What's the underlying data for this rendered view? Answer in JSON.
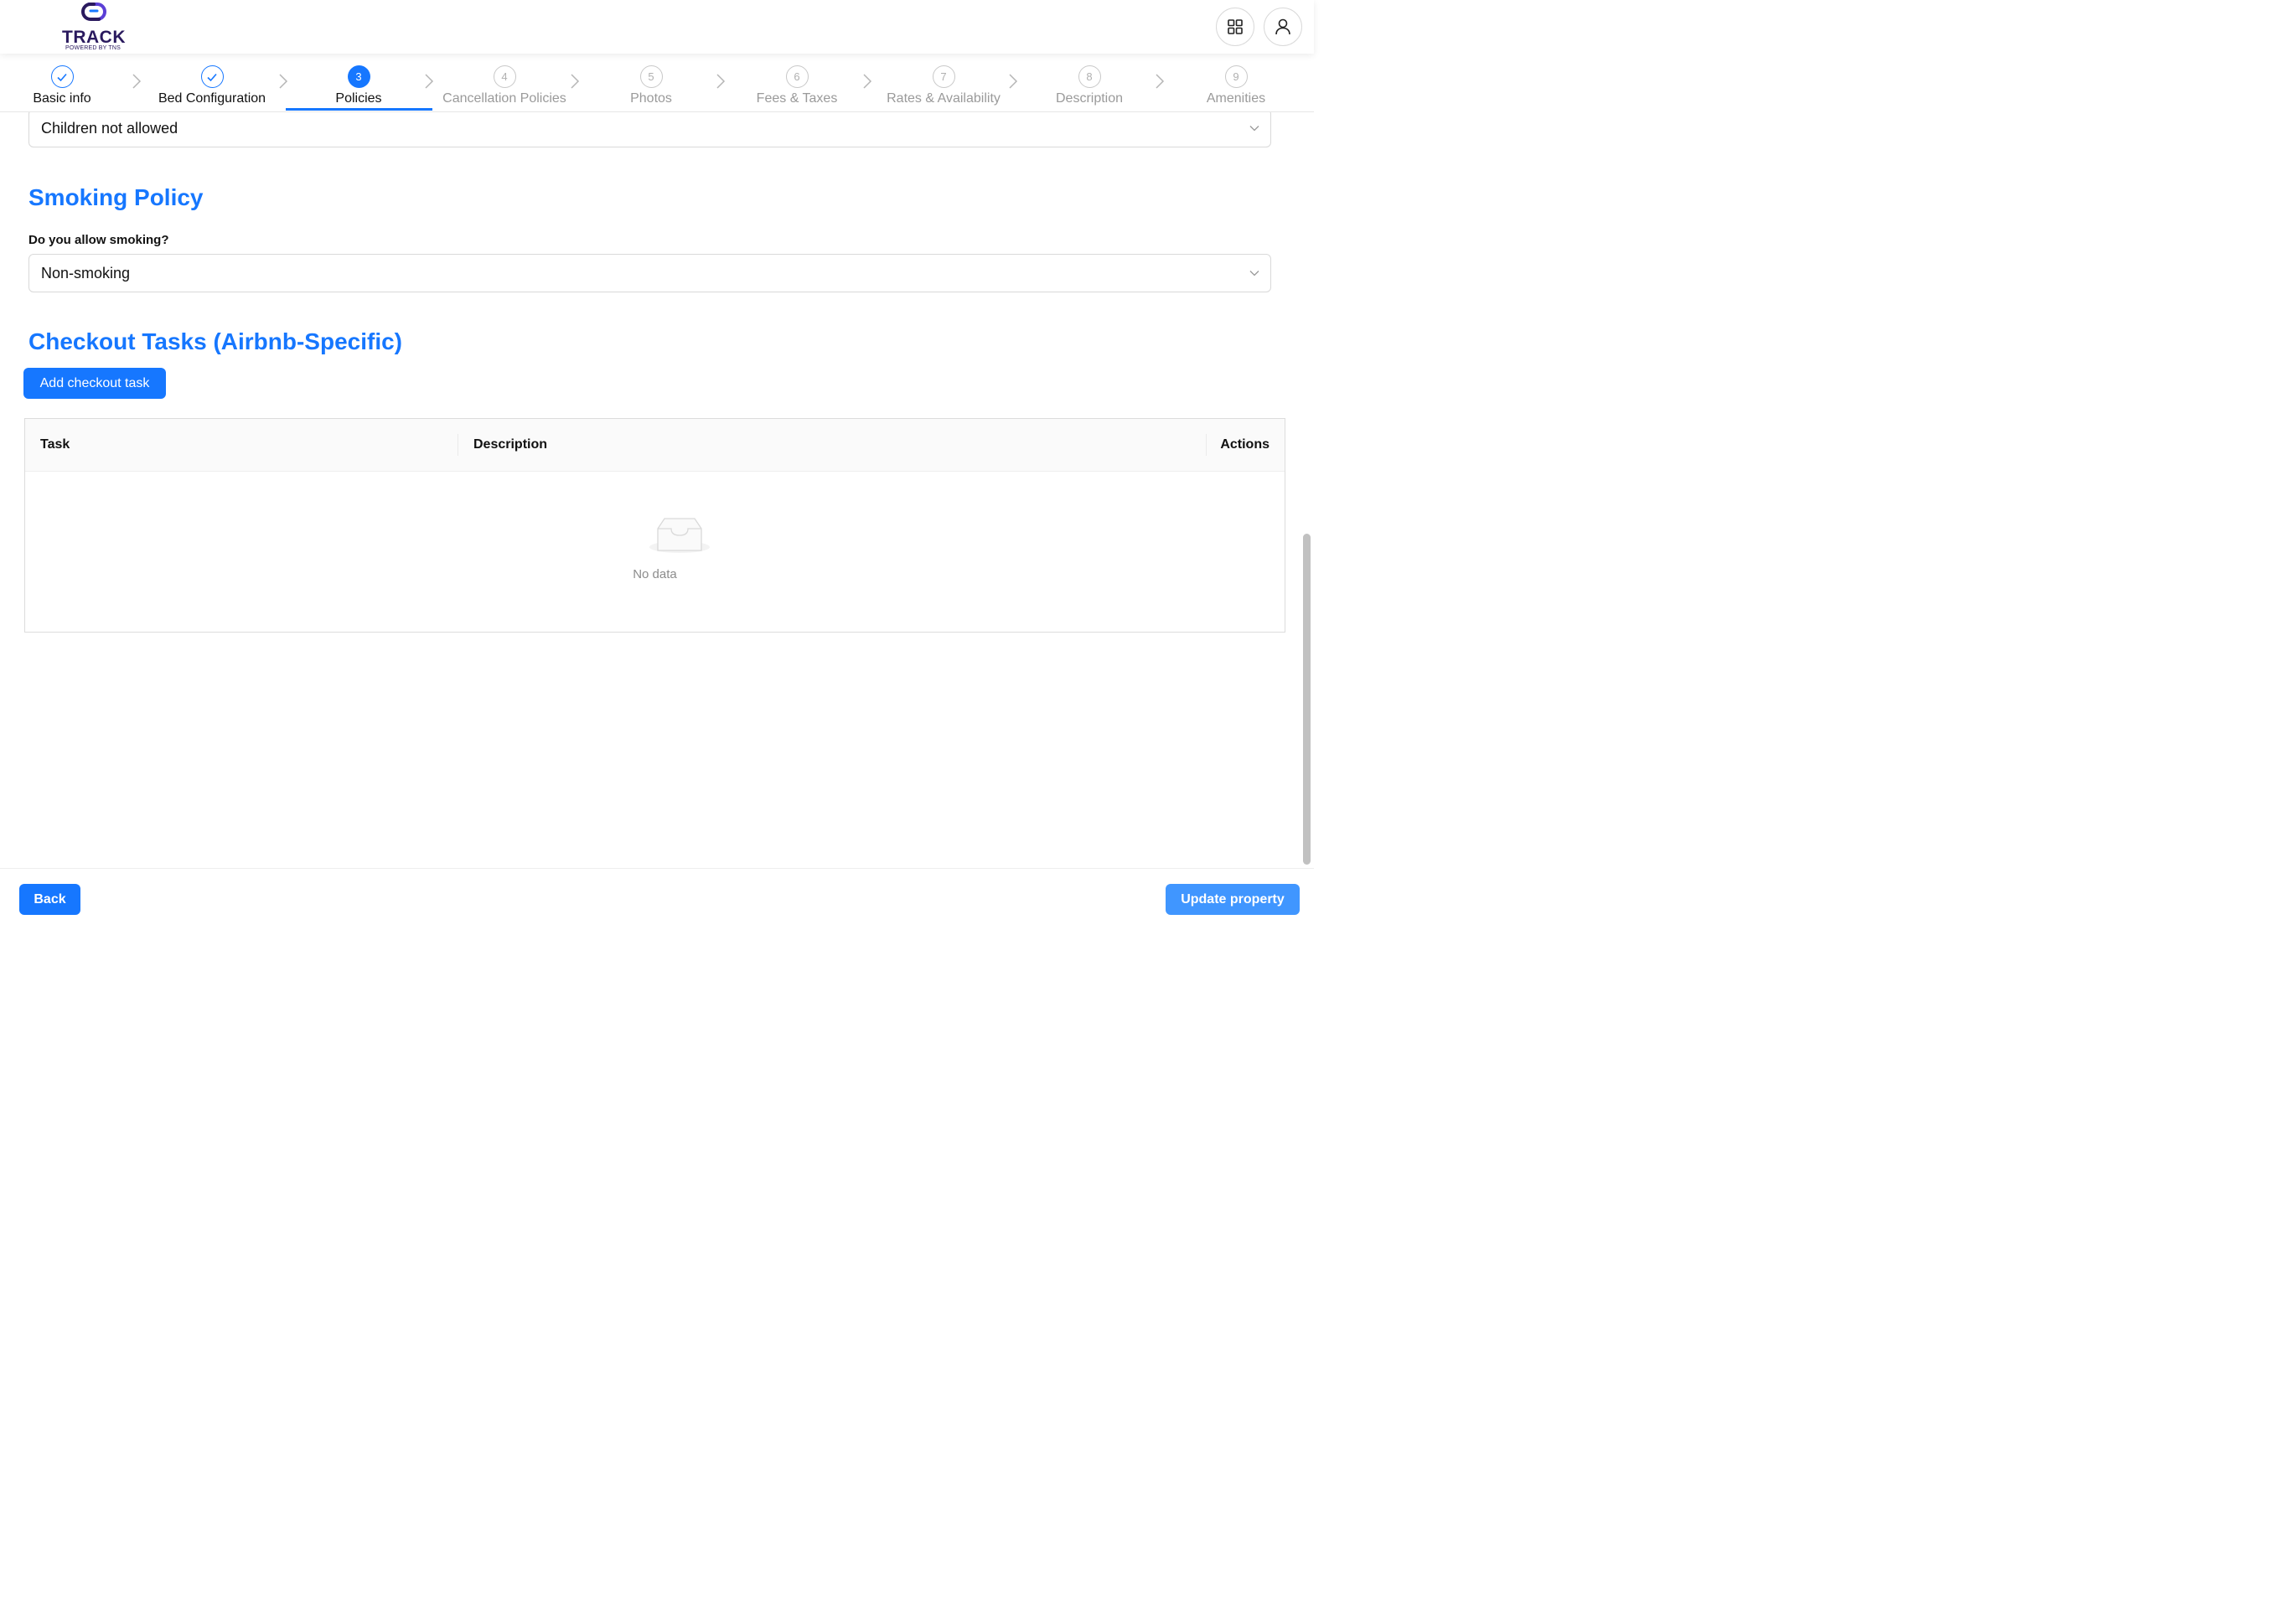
{
  "header": {
    "logo_text": "TRACK",
    "logo_subtext": "POWERED BY TNS",
    "apps_icon": "grid-icon",
    "user_icon": "user-icon"
  },
  "steps": [
    {
      "number": "1",
      "label": "Basic info",
      "status": "done"
    },
    {
      "number": "2",
      "label": "Bed Configuration",
      "status": "done"
    },
    {
      "number": "3",
      "label": "Policies",
      "status": "active"
    },
    {
      "number": "4",
      "label": "Cancellation Policies",
      "status": "todo"
    },
    {
      "number": "5",
      "label": "Photos",
      "status": "todo"
    },
    {
      "number": "6",
      "label": "Fees & Taxes",
      "status": "todo"
    },
    {
      "number": "7",
      "label": "Rates & Availability",
      "status": "todo"
    },
    {
      "number": "8",
      "label": "Description",
      "status": "todo"
    },
    {
      "number": "9",
      "label": "Amenities",
      "status": "todo"
    }
  ],
  "children_policy": {
    "value": "Children not allowed"
  },
  "smoking_policy": {
    "title": "Smoking Policy",
    "question": "Do you allow smoking?",
    "value": "Non-smoking"
  },
  "checkout_tasks": {
    "title": "Checkout Tasks (Airbnb-Specific)",
    "add_button": "Add checkout task",
    "columns": [
      "Task",
      "Description",
      "Actions"
    ],
    "rows": [],
    "empty_text": "No data"
  },
  "footer": {
    "back_label": "Back",
    "update_label": "Update property"
  },
  "colors": {
    "primary": "#1677ff",
    "brand": "#2a1a5e",
    "muted": "#9a9a9a"
  }
}
